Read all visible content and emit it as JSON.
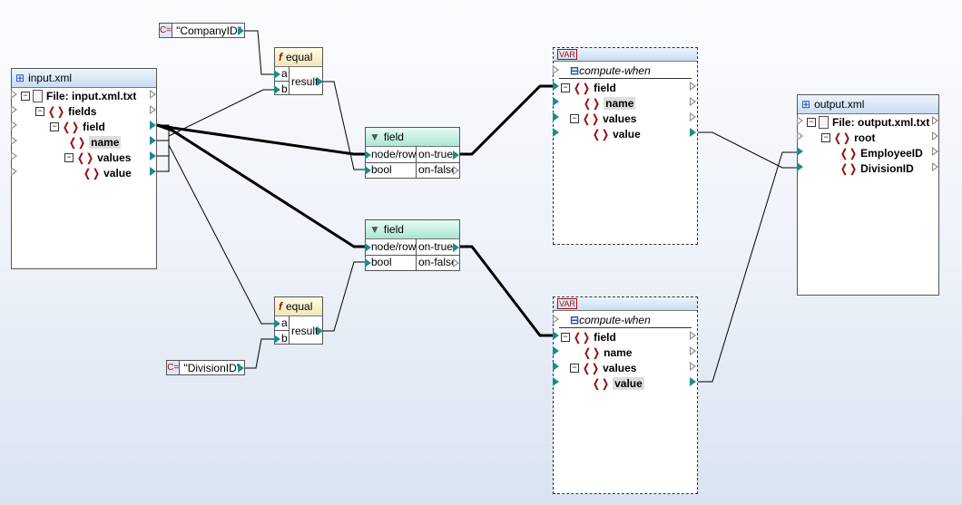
{
  "input": {
    "title": "input.xml",
    "icon": "xml-schema-icon",
    "rows": [
      {
        "label": "File: input.xml.txt",
        "type": "file",
        "depth": 0,
        "exp": true,
        "inPort": "empty",
        "outPort": "empty"
      },
      {
        "label": "fields",
        "type": "elem",
        "depth": 1,
        "exp": true,
        "inPort": "empty",
        "outPort": "empty"
      },
      {
        "label": "field",
        "type": "elem",
        "depth": 2,
        "exp": true,
        "inPort": "empty",
        "outPort": "filled"
      },
      {
        "label": "name",
        "type": "elem",
        "depth": 3,
        "exp": false,
        "sel": true,
        "inPort": "empty",
        "outPort": "filled"
      },
      {
        "label": "values",
        "type": "elem",
        "depth": 3,
        "exp": true,
        "inPort": "empty",
        "outPort": "filled"
      },
      {
        "label": "value",
        "type": "elem",
        "depth": 4,
        "exp": false,
        "inPort": "empty",
        "outPort": "filled"
      }
    ]
  },
  "output": {
    "title": "output.xml",
    "icon": "xml-schema-icon",
    "rows": [
      {
        "label": "File: output.xml.txt",
        "type": "file",
        "depth": 0,
        "exp": true,
        "inPort": "empty",
        "outPort": "empty"
      },
      {
        "label": "root",
        "type": "elem",
        "depth": 1,
        "exp": true,
        "inPort": "empty",
        "outPort": "empty"
      },
      {
        "label": "EmployeeID",
        "type": "elem",
        "depth": 2,
        "exp": false,
        "inPort": "filled",
        "outPort": "empty"
      },
      {
        "label": "DivisionID",
        "type": "elem",
        "depth": 2,
        "exp": false,
        "inPort": "filled",
        "outPort": "empty"
      }
    ]
  },
  "constants": [
    {
      "value": "\"CompanyID\"",
      "icon": "C="
    },
    {
      "value": "\"DivisionID\"",
      "icon": "C="
    }
  ],
  "functions": [
    {
      "title": "equal",
      "inputs": [
        "a",
        "b"
      ],
      "output": "result"
    },
    {
      "title": "equal",
      "inputs": [
        "a",
        "b"
      ],
      "output": "result"
    }
  ],
  "filters": [
    {
      "title": "field",
      "inputs": [
        "node/row",
        "bool"
      ],
      "outputs": [
        "on-true",
        "on-false"
      ]
    },
    {
      "title": "field",
      "inputs": [
        "node/row",
        "bool"
      ],
      "outputs": [
        "on-true",
        "on-false"
      ]
    }
  ],
  "variables": [
    {
      "badge": "VAR",
      "compute": "compute-when",
      "rows": [
        {
          "label": "field",
          "depth": 0,
          "exp": true,
          "outPort": "empty"
        },
        {
          "label": "name",
          "depth": 1,
          "exp": false,
          "sel": true,
          "outPort": "empty"
        },
        {
          "label": "values",
          "depth": 1,
          "exp": true,
          "outPort": "empty"
        },
        {
          "label": "value",
          "depth": 2,
          "exp": false,
          "outPort": "filled"
        }
      ]
    },
    {
      "badge": "VAR",
      "compute": "compute-when",
      "rows": [
        {
          "label": "field",
          "depth": 0,
          "exp": true,
          "outPort": "empty"
        },
        {
          "label": "name",
          "depth": 1,
          "exp": false,
          "outPort": "empty"
        },
        {
          "label": "values",
          "depth": 1,
          "exp": true,
          "outPort": "empty"
        },
        {
          "label": "value",
          "depth": 2,
          "exp": false,
          "sel": true,
          "outPort": "filled"
        }
      ]
    }
  ],
  "colors": {
    "port": "#1c8a90",
    "element": "#9a1010"
  }
}
